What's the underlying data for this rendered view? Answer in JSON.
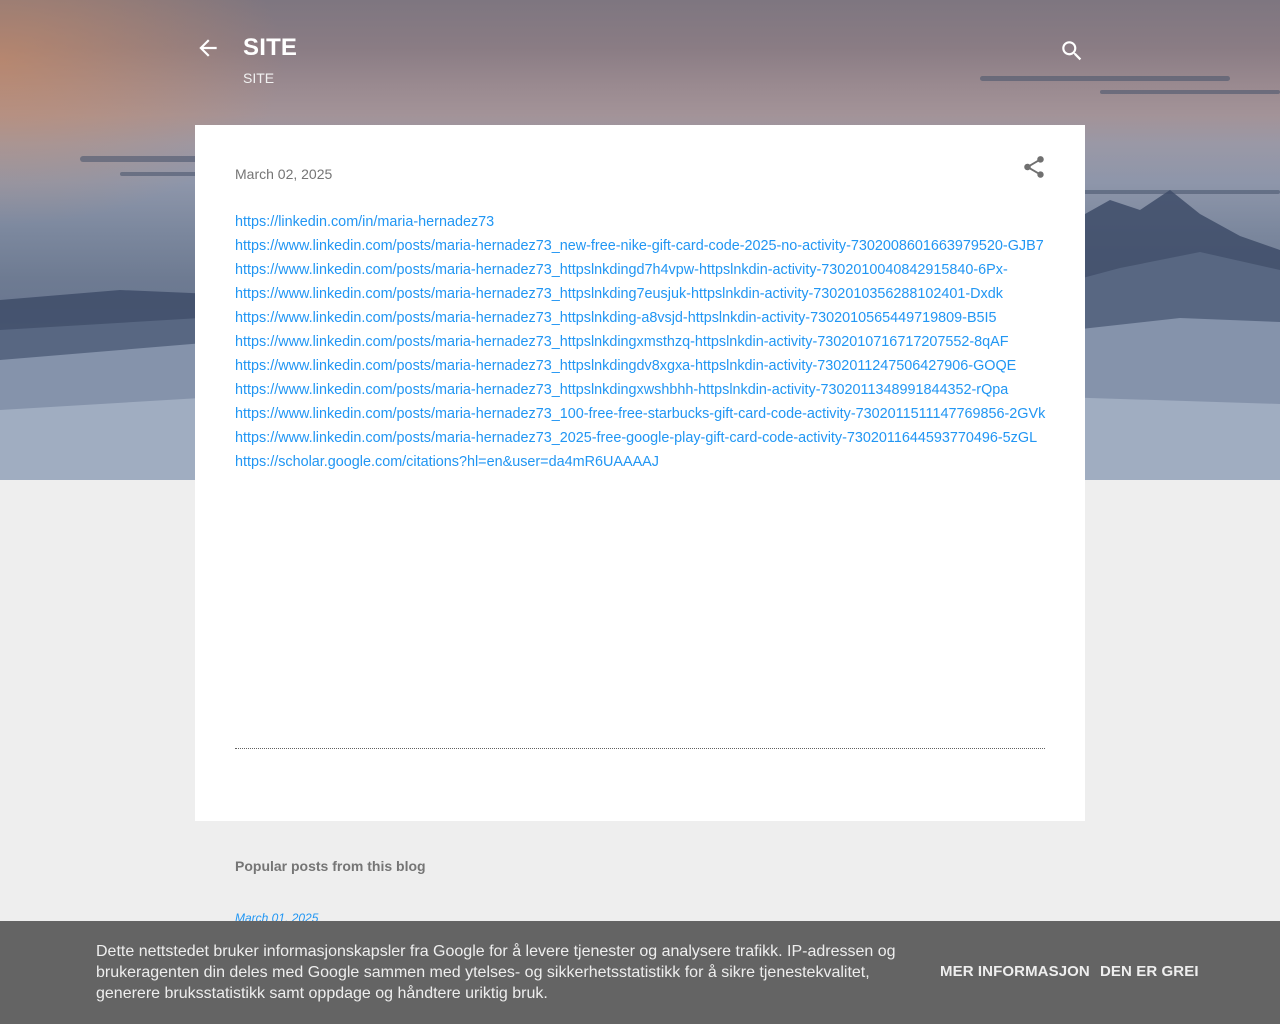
{
  "header": {
    "title": "SITE",
    "description": "SITE",
    "back_icon": "arrow-back-icon",
    "search_icon": "search-icon"
  },
  "post": {
    "date": "March 02, 2025",
    "share_icon": "share-icon",
    "links": [
      "https://linkedin.com/in/maria-hernadez73",
      "https://www.linkedin.com/posts/maria-hernadez73_new-free-nike-gift-card-code-2025-no-activity-7302008601663979520-GJB7",
      "https://www.linkedin.com/posts/maria-hernadez73_httpslnkdingd7h4vpw-httpslnkdin-activity-7302010040842915840-6Px-",
      "https://www.linkedin.com/posts/maria-hernadez73_httpslnkding7eusjuk-httpslnkdin-activity-7302010356288102401-Dxdk",
      "https://www.linkedin.com/posts/maria-hernadez73_httpslnkding-a8vsjd-httpslnkdin-activity-7302010565449719809-B5I5",
      "https://www.linkedin.com/posts/maria-hernadez73_httpslnkdingxmsthzq-httpslnkdin-activity-7302010716717207552-8qAF",
      "https://www.linkedin.com/posts/maria-hernadez73_httpslnkdingdv8xgxa-httpslnkdin-activity-7302011247506427906-GOQE",
      "https://www.linkedin.com/posts/maria-hernadez73_httpslnkdingxwshbhh-httpslnkdin-activity-7302011348991844352-rQpa",
      "https://www.linkedin.com/posts/maria-hernadez73_100-free-free-starbucks-gift-card-code-activity-7302011511147769856-2GVk",
      "https://www.linkedin.com/posts/maria-hernadez73_2025-free-google-play-gift-card-code-activity-7302011644593770496-5zGL",
      "https://scholar.google.com/citations?hl=en&user=da4mR6UAAAAJ"
    ]
  },
  "popular": {
    "title": "Popular posts from this blog",
    "first_date": "March 01, 2025"
  },
  "cookie": {
    "text": "Dette nettstedet bruker informasjonskapsler fra Google for å levere tjenester og analysere trafikk. IP-adressen og brukeragenten din deles med Google sammen med ytelses- og sikkerhetsstatistikk for å sikre tjenestekvalitet, generere bruksstatistikk samt oppdage og håndtere uriktig bruk.",
    "more_label": "MER INFORMASJON",
    "ok_label": "DEN ER GREI"
  },
  "colors": {
    "link": "#2196f3",
    "card": "#ffffff",
    "page_bg": "#eeeeee",
    "cookie_bg": "#646464"
  }
}
